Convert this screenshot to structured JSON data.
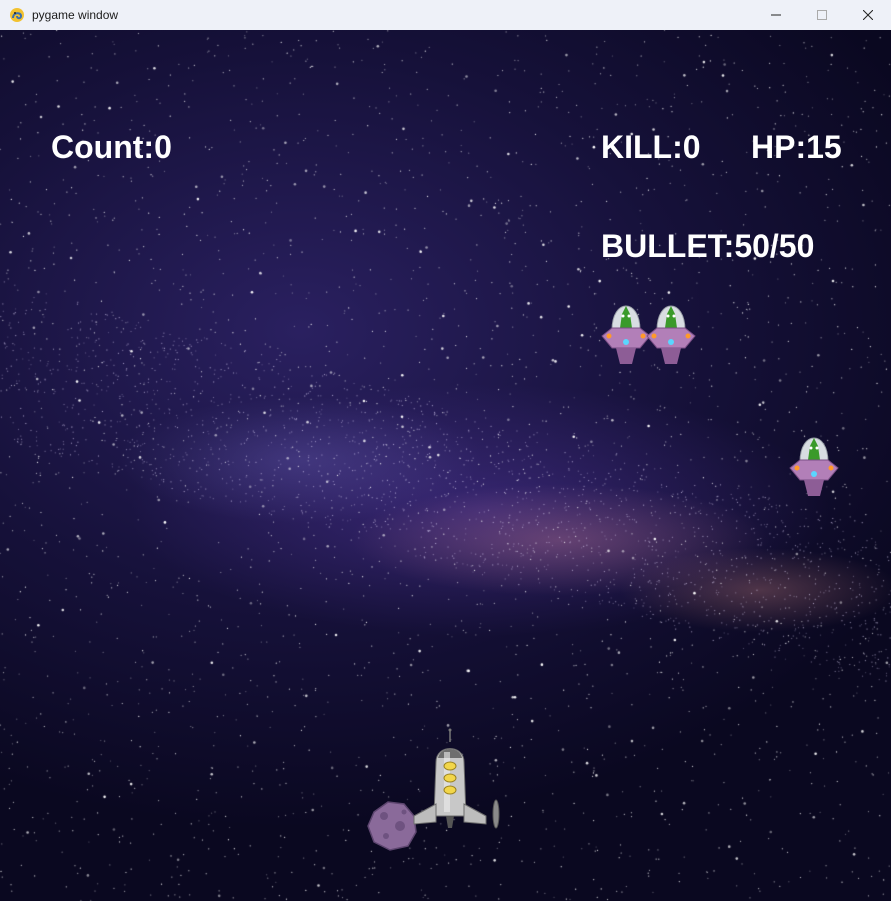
{
  "window": {
    "title": "pygame window",
    "controls": [
      "minimize",
      "maximize",
      "close"
    ]
  },
  "hud": {
    "count_label": "Count:",
    "count_value": "0",
    "kill_label": "KILL:",
    "kill_value": "0",
    "hp_label": "HP:",
    "hp_value": "15",
    "bullet_label": "BULLET:",
    "bullet_value": "50/50"
  },
  "sprites": {
    "enemies": [
      "ufo-enemy",
      "ufo-enemy",
      "ufo-enemy"
    ],
    "player": "rocket-ship",
    "obstacle": "asteroid"
  },
  "colors": {
    "hud_text": "#ffffff",
    "ufo_body": "#b27fb8",
    "alien": "#3a9a2a",
    "rocket": "#c8c8c8",
    "asteroid": "#8a6a9a"
  }
}
